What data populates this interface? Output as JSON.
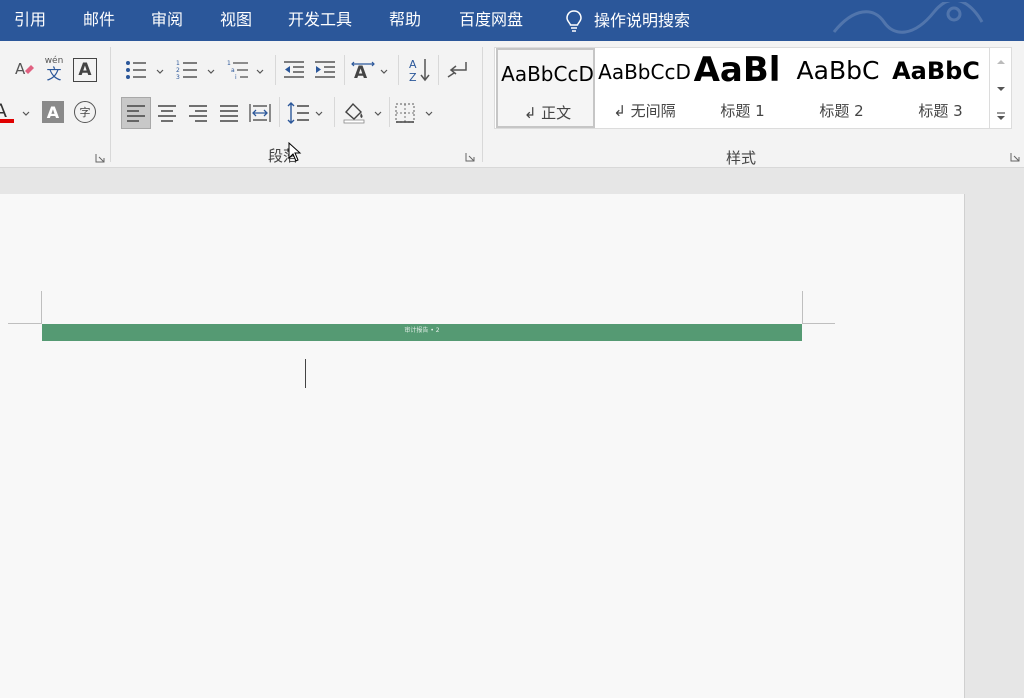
{
  "menu": {
    "items": [
      "引用",
      "邮件",
      "审阅",
      "视图",
      "开发工具",
      "帮助",
      "百度网盘"
    ],
    "tell_me": "操作说明搜索",
    "background": "#2b579a"
  },
  "ribbon": {
    "groups": {
      "font_partial": {
        "icons": [
          "eraser-icon",
          "phonetic-guide-icon",
          "character-border-icon",
          "font-color-icon",
          "character-shading-icon",
          "enclose-character-icon"
        ],
        "phonetic_text": "wén",
        "phonetic_char": "文",
        "border_char": "A",
        "font_color_char": "A",
        "shading_char": "A",
        "enclose_char": "字"
      },
      "paragraph": {
        "label": "段落",
        "icons": [
          "bullets-icon",
          "numbering-icon",
          "multilevel-list-icon",
          "decrease-indent-icon",
          "increase-indent-icon",
          "chinese-layout-icon",
          "sort-icon",
          "show-marks-icon",
          "align-left-icon",
          "center-icon",
          "align-right-icon",
          "justify-icon",
          "distributed-icon",
          "line-spacing-icon",
          "shading-icon",
          "borders-icon"
        ],
        "sort_text": "AZ"
      },
      "styles": {
        "label": "样式",
        "items": [
          {
            "sample": "AaBbCcD",
            "name": "↲ 正文",
            "selected": true
          },
          {
            "sample": "AaBbCcD",
            "name": "↲ 无间隔",
            "selected": false
          },
          {
            "sample": "AaBl",
            "name": "标题 1",
            "selected": false
          },
          {
            "sample": "AaBbC",
            "name": "标题 2",
            "selected": false
          },
          {
            "sample": "AaBbC",
            "name": "标题 3",
            "selected": false
          }
        ]
      }
    }
  },
  "document": {
    "header_band_color": "#559a73",
    "header_band_text": "审计报告 • 2",
    "page_color": "#f8f8f8"
  }
}
